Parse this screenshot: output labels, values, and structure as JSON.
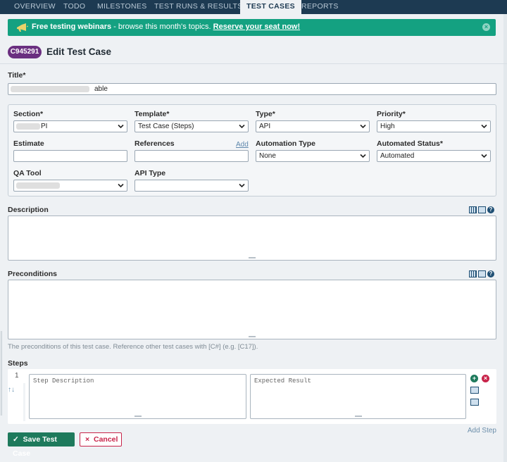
{
  "nav": {
    "tabs": [
      {
        "label": "OVERVIEW"
      },
      {
        "label": "TODO"
      },
      {
        "label": "MILESTONES"
      },
      {
        "label": "TEST RUNS & RESULTS"
      },
      {
        "label": "TEST CASES"
      },
      {
        "label": "REPORTS"
      }
    ],
    "active_tab": "TEST CASES"
  },
  "banner": {
    "bold_text": "Free testing webinars",
    "text": " - browse this month's topics. ",
    "link_text": "Reserve your seat now!",
    "icon": "megaphone-icon",
    "close_icon": "close-icon",
    "color": "#14a181"
  },
  "page": {
    "case_id": "C945291",
    "title": "Edit Test Case",
    "badge_color": "#6a2f80"
  },
  "form": {
    "title_label": "Title",
    "title_value": "able",
    "required_mark": "*",
    "section": {
      "label": "Section",
      "value": "PI"
    },
    "template": {
      "label": "Template",
      "value": "Test Case (Steps)"
    },
    "type": {
      "label": "Type",
      "value": "API"
    },
    "priority": {
      "label": "Priority",
      "value": "High"
    },
    "estimate": {
      "label": "Estimate",
      "value": ""
    },
    "references": {
      "label": "References",
      "value": "",
      "add_link": "Add"
    },
    "automation_type": {
      "label": "Automation Type",
      "value": "None"
    },
    "automated_status": {
      "label": "Automated Status",
      "value": "Automated"
    },
    "qa_tool": {
      "label": "QA Tool",
      "value": ""
    },
    "api_type": {
      "label": "API Type",
      "value": ""
    },
    "description": {
      "label": "Description",
      "value": ""
    },
    "preconditions": {
      "label": "Preconditions",
      "value": "",
      "hint": "The preconditions of this test case. Reference other test cases with [C#] (e.g. [C17])."
    },
    "steps": {
      "label": "Steps",
      "rows": [
        {
          "number": "1",
          "move": "↑↓",
          "description_placeholder": "Step Description",
          "expected_placeholder": "Expected Result"
        }
      ],
      "add_step": "Add Step"
    }
  },
  "actions": {
    "save_label": "Save Test Case",
    "cancel_label": "Cancel",
    "save_color": "#1e7a5c",
    "cancel_color": "#c8244a"
  }
}
